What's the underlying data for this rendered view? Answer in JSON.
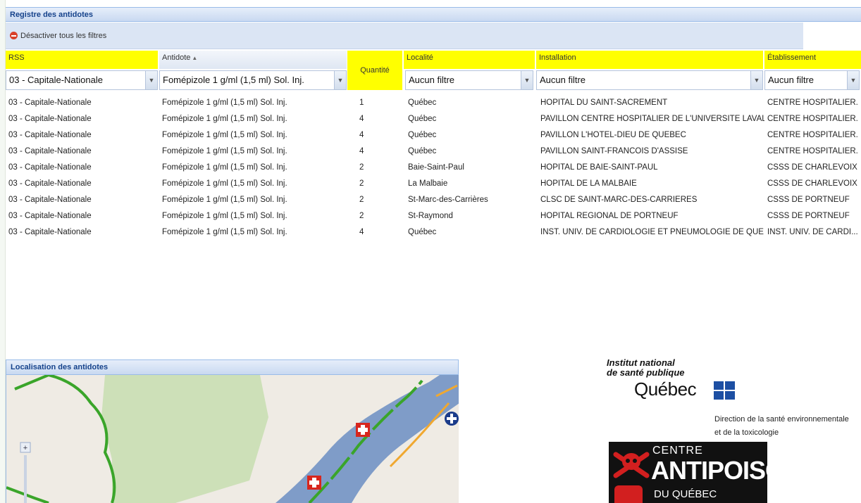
{
  "panel": {
    "title": "Registre des antidotes"
  },
  "toolbar": {
    "clear_filters_label": "Désactiver tous les filtres"
  },
  "columns": {
    "rss": "RSS",
    "antidote": "Antidote",
    "quantite": "Quantité",
    "localite": "Localité",
    "installation": "Installation",
    "etablissement": "Établissement"
  },
  "filters": {
    "rss": "03 - Capitale-Nationale",
    "antidote": "Fomépizole 1 g/ml (1,5 ml) Sol. Inj.",
    "localite": "Aucun filtre",
    "installation": "Aucun filtre",
    "etablissement": "Aucun filtre"
  },
  "rows": [
    {
      "rss": "03 - Capitale-Nationale",
      "antidote": "Fomépizole 1 g/ml (1,5 ml) Sol. Inj.",
      "quantite": "1",
      "localite": "Québec",
      "installation": "HOPITAL DU SAINT-SACREMENT",
      "etablissement": "CENTRE HOSPITALIER..."
    },
    {
      "rss": "03 - Capitale-Nationale",
      "antidote": "Fomépizole 1 g/ml (1,5 ml) Sol. Inj.",
      "quantite": "4",
      "localite": "Québec",
      "installation": "PAVILLON CENTRE HOSPITALIER DE L'UNIVERSITE LAVAL",
      "etablissement": "CENTRE HOSPITALIER..."
    },
    {
      "rss": "03 - Capitale-Nationale",
      "antidote": "Fomépizole 1 g/ml (1,5 ml) Sol. Inj.",
      "quantite": "4",
      "localite": "Québec",
      "installation": "PAVILLON L'HOTEL-DIEU DE QUEBEC",
      "etablissement": "CENTRE HOSPITALIER..."
    },
    {
      "rss": "03 - Capitale-Nationale",
      "antidote": "Fomépizole 1 g/ml (1,5 ml) Sol. Inj.",
      "quantite": "4",
      "localite": "Québec",
      "installation": "PAVILLON SAINT-FRANCOIS D'ASSISE",
      "etablissement": "CENTRE HOSPITALIER..."
    },
    {
      "rss": "03 - Capitale-Nationale",
      "antidote": "Fomépizole 1 g/ml (1,5 ml) Sol. Inj.",
      "quantite": "2",
      "localite": "Baie-Saint-Paul",
      "installation": "HOPITAL DE BAIE-SAINT-PAUL",
      "etablissement": "CSSS DE CHARLEVOIX"
    },
    {
      "rss": "03 - Capitale-Nationale",
      "antidote": "Fomépizole 1 g/ml (1,5 ml) Sol. Inj.",
      "quantite": "2",
      "localite": "La Malbaie",
      "installation": "HOPITAL DE LA MALBAIE",
      "etablissement": "CSSS DE CHARLEVOIX"
    },
    {
      "rss": "03 - Capitale-Nationale",
      "antidote": "Fomépizole 1 g/ml (1,5 ml) Sol. Inj.",
      "quantite": "2",
      "localite": "St-Marc-des-Carrières",
      "installation": "CLSC DE SAINT-MARC-DES-CARRIERES",
      "etablissement": "CSSS DE PORTNEUF"
    },
    {
      "rss": "03 - Capitale-Nationale",
      "antidote": "Fomépizole 1 g/ml (1,5 ml) Sol. Inj.",
      "quantite": "2",
      "localite": "St-Raymond",
      "installation": "HOPITAL REGIONAL DE PORTNEUF",
      "etablissement": "CSSS DE PORTNEUF"
    },
    {
      "rss": "03 - Capitale-Nationale",
      "antidote": "Fomépizole 1 g/ml (1,5 ml) Sol. Inj.",
      "quantite": "4",
      "localite": "Québec",
      "installation": "INST. UNIV. DE CARDIOLOGIE ET PNEUMOLOGIE DE QUE...",
      "etablissement": "INST. UNIV. DE CARDI..."
    }
  ],
  "map": {
    "title": "Localisation des antidotes",
    "zoom_in_label": "+",
    "colors": {
      "water": "#7f9cc8",
      "park": "#cde0b8",
      "border": "#3aa52a",
      "road": "#f0a830",
      "marker": "#d8261d"
    }
  },
  "logos": {
    "inspq_line1": "Institut national",
    "inspq_line2": "de santé publique",
    "quebec": "Québec",
    "direction_line1": "Direction de la santé environnementale",
    "direction_line2": "et de la toxicologie",
    "antipoison_top": "CENTRE",
    "antipoison_main": "ANTIPOISON",
    "antipoison_bottom": "DU QUÉBEC"
  }
}
